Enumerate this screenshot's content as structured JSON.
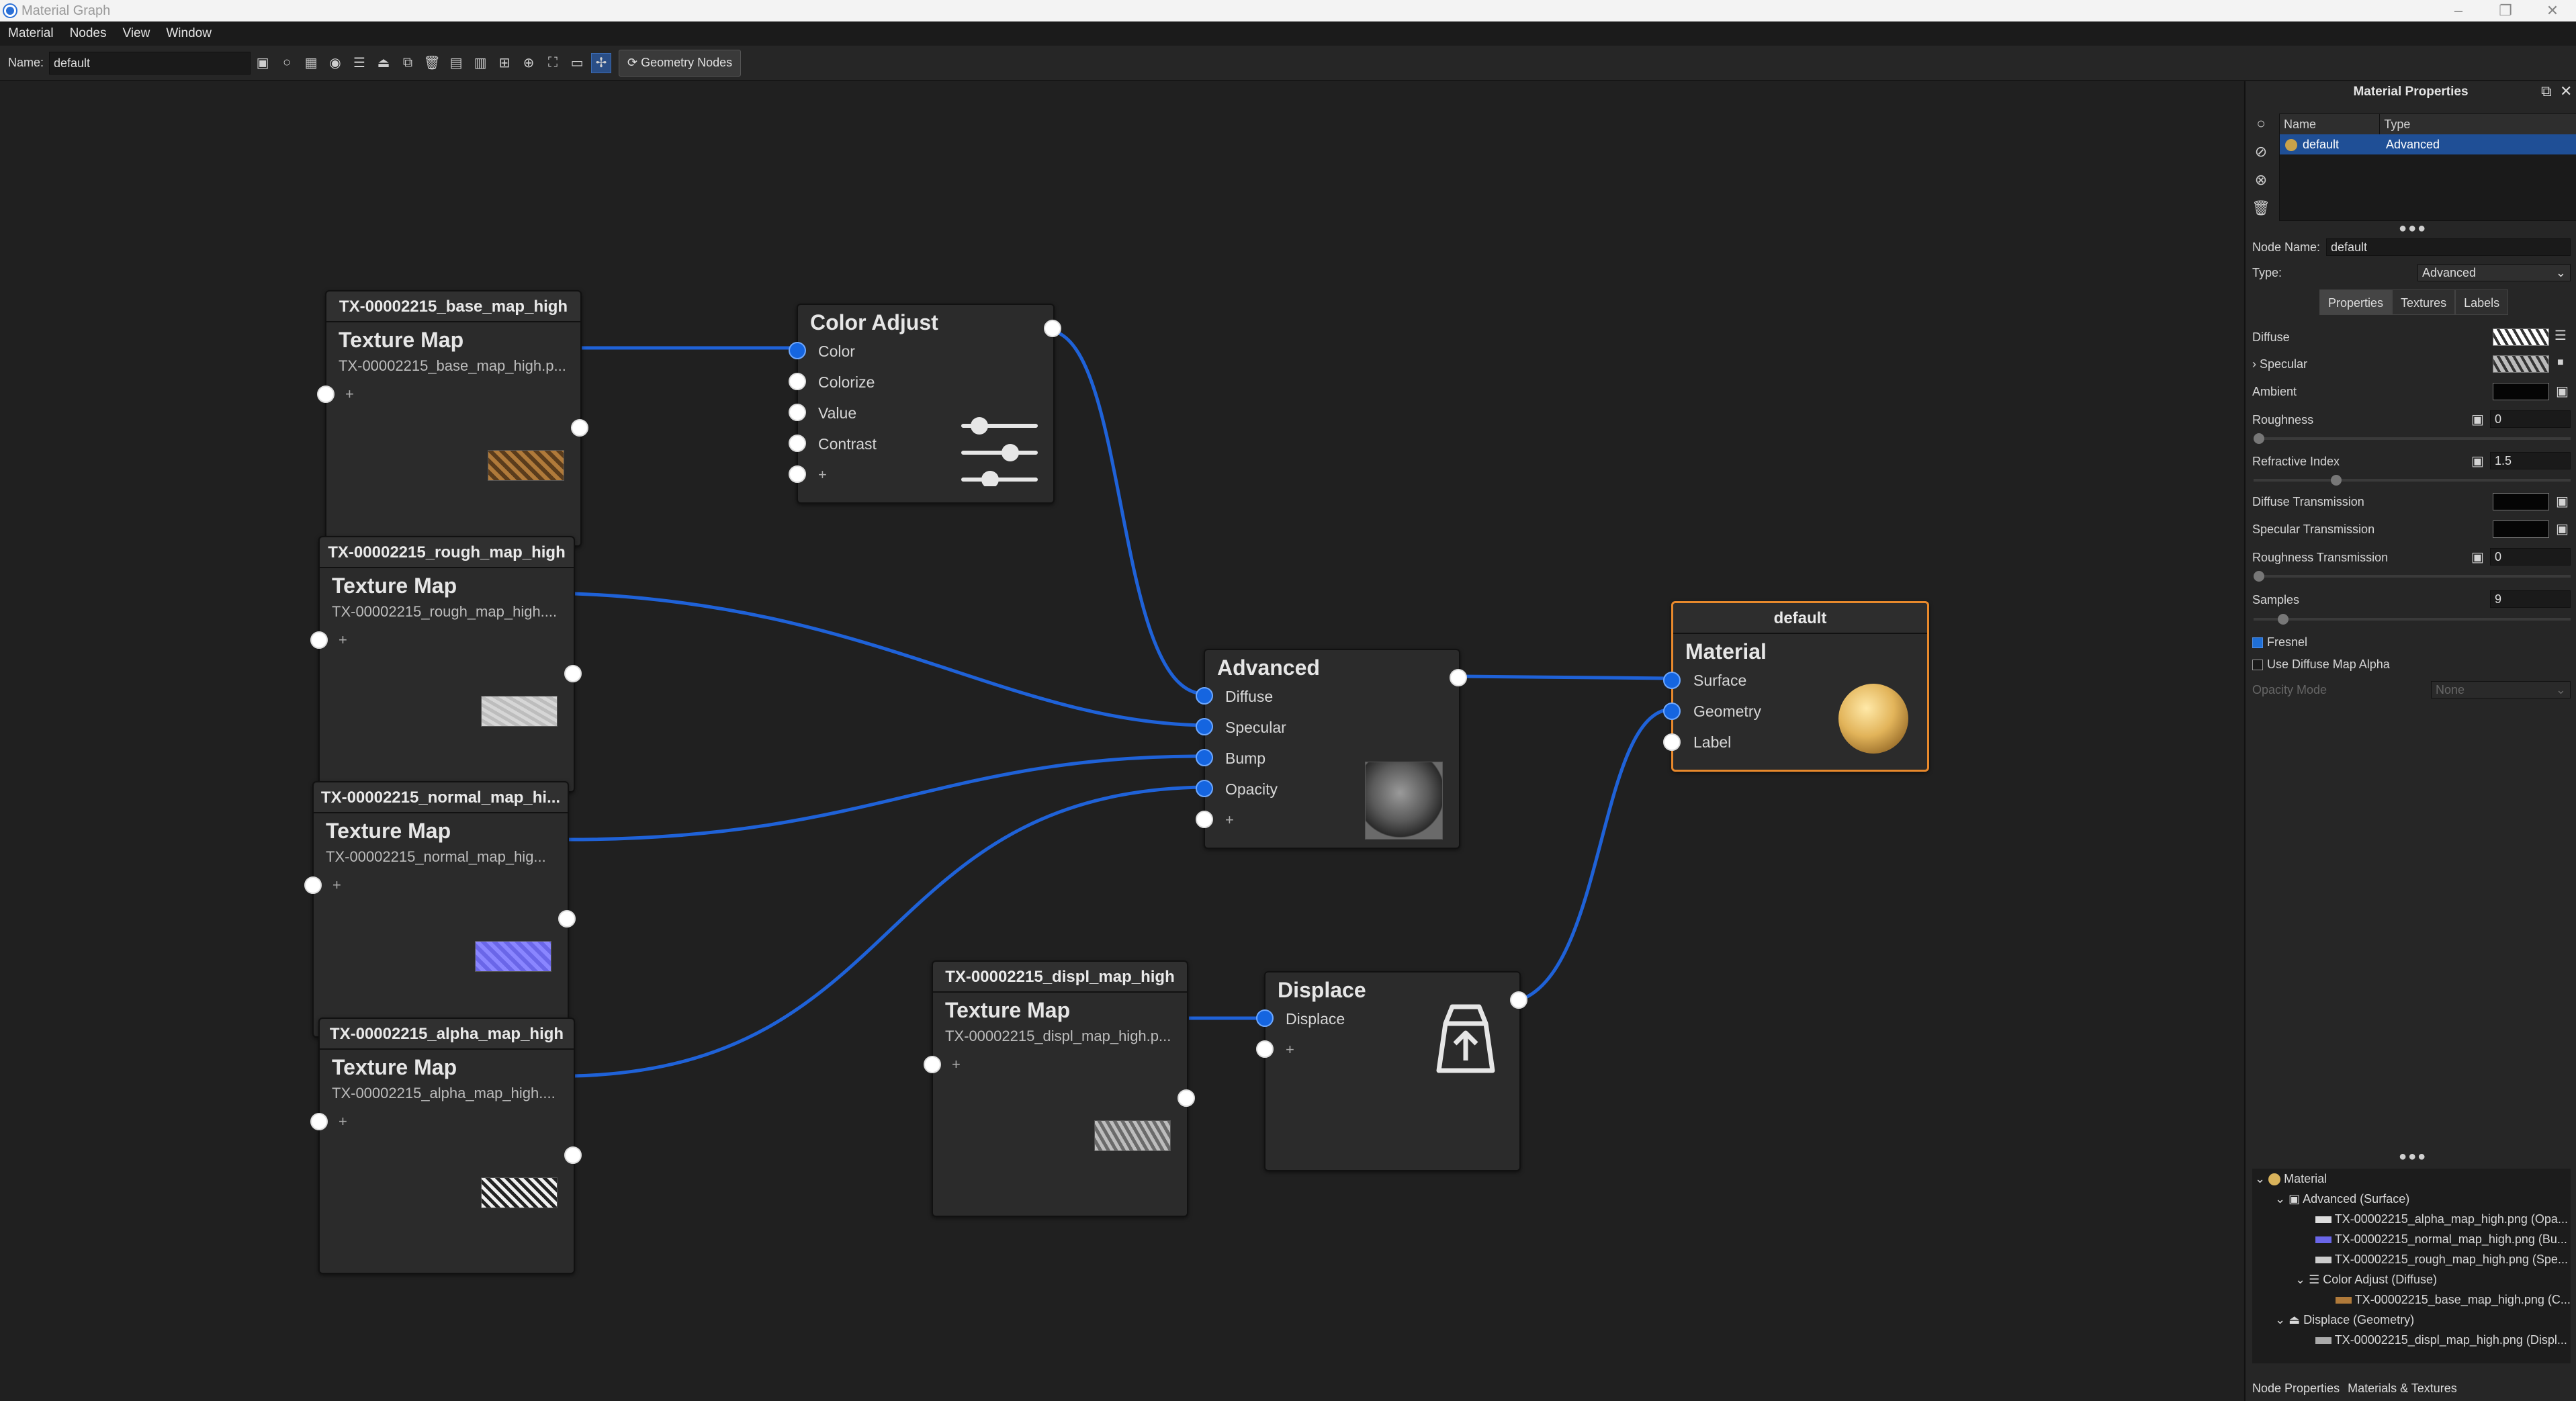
{
  "window": {
    "title": "Material Graph"
  },
  "menu": [
    "Material",
    "Nodes",
    "View",
    "Window"
  ],
  "toolbar": {
    "name_label": "Name:",
    "name_value": "default",
    "geometry_nodes_label": "Geometry Nodes"
  },
  "nodes": {
    "tex_base": {
      "header": "TX-00002215_base_map_high",
      "title": "Texture Map",
      "subtitle": "TX-00002215_base_map_high.p...",
      "plus": "+"
    },
    "tex_rough": {
      "header": "TX-00002215_rough_map_high",
      "title": "Texture Map",
      "subtitle": "TX-00002215_rough_map_high....",
      "plus": "+"
    },
    "tex_normal": {
      "header": "TX-00002215_normal_map_hi...",
      "title": "Texture Map",
      "subtitle": "TX-00002215_normal_map_hig...",
      "plus": "+"
    },
    "tex_alpha": {
      "header": "TX-00002215_alpha_map_high",
      "title": "Texture Map",
      "subtitle": "TX-00002215_alpha_map_high....",
      "plus": "+"
    },
    "tex_displ": {
      "header": "TX-00002215_displ_map_high",
      "title": "Texture Map",
      "subtitle": "TX-00002215_displ_map_high.p...",
      "plus": "+"
    },
    "color_adjust": {
      "title": "Color Adjust",
      "ports": [
        "Color",
        "Colorize",
        "Value",
        "Contrast"
      ],
      "plus": "+"
    },
    "advanced": {
      "title": "Advanced",
      "ports": [
        "Diffuse",
        "Specular",
        "Bump",
        "Opacity"
      ],
      "plus": "+"
    },
    "displace": {
      "title": "Displace",
      "ports": [
        "Displace"
      ],
      "plus": "+"
    },
    "material": {
      "header": "default",
      "title": "Material",
      "ports": [
        "Surface",
        "Geometry",
        "Label"
      ]
    }
  },
  "panel": {
    "title": "Material Properties",
    "list_headers": {
      "name": "Name",
      "type": "Type"
    },
    "list_row": {
      "name": "default",
      "type": "Advanced"
    },
    "node_name_label": "Node Name:",
    "node_name_value": "default",
    "type_label": "Type:",
    "type_value": "Advanced",
    "tabs": [
      "Properties",
      "Textures",
      "Labels"
    ],
    "props": {
      "diffuse": "Diffuse",
      "specular": "Specular",
      "ambient": "Ambient",
      "roughness": "Roughness",
      "roughness_value": "0",
      "refractive_index": "Refractive Index",
      "refractive_value": "1.5",
      "diffuse_transmission": "Diffuse Transmission",
      "specular_transmission": "Specular Transmission",
      "roughness_transmission": "Roughness Transmission",
      "roughness_transmission_value": "0",
      "samples": "Samples",
      "samples_value": "9",
      "fresnel": "Fresnel",
      "use_diffuse_alpha": "Use Diffuse Map Alpha",
      "opacity_mode": "Opacity Mode",
      "opacity_mode_value": "None"
    },
    "tree": [
      "Material",
      "Advanced (Surface)",
      "TX-00002215_alpha_map_high.png (Opa...",
      "TX-00002215_normal_map_high.png (Bu...",
      "TX-00002215_rough_map_high.png (Spe...",
      "Color Adjust (Diffuse)",
      "TX-00002215_base_map_high.png (C...",
      "Displace (Geometry)",
      "TX-00002215_displ_map_high.png (Displ..."
    ],
    "bottom_tabs": [
      "Node Properties",
      "Materials & Textures"
    ]
  },
  "colors": {
    "wire": "#1f62d8",
    "port_active": "#1565e0",
    "selected_border": "#e8892c"
  }
}
